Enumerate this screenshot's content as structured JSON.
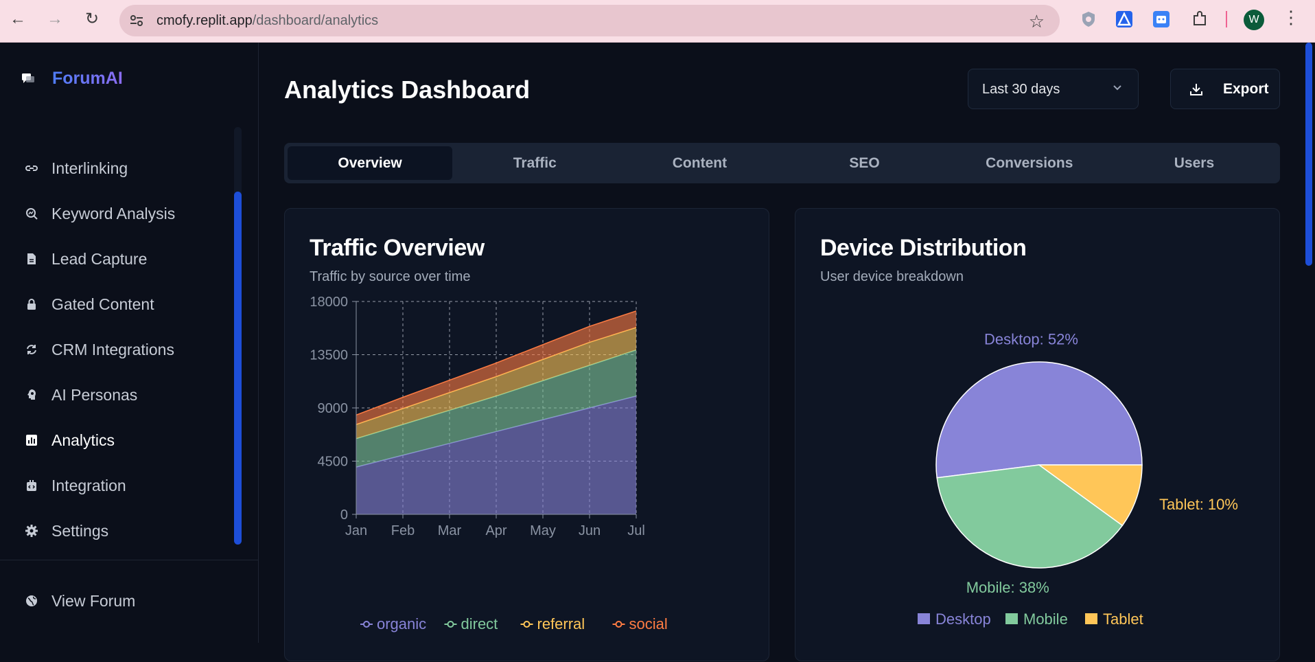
{
  "browser": {
    "url_host": "cmofy.replit.app",
    "url_path": "/dashboard/analytics",
    "avatar_letter": "W"
  },
  "sidebar": {
    "brand": "ForumAI",
    "items": [
      {
        "label": "Interlinking",
        "icon": "link-icon"
      },
      {
        "label": "Keyword Analysis",
        "icon": "search-chart-icon"
      },
      {
        "label": "Lead Capture",
        "icon": "document-icon"
      },
      {
        "label": "Gated Content",
        "icon": "lock-icon"
      },
      {
        "label": "CRM Integrations",
        "icon": "refresh-icon"
      },
      {
        "label": "AI Personas",
        "icon": "head-icon"
      },
      {
        "label": "Analytics",
        "icon": "bar-chart-icon",
        "active": true
      },
      {
        "label": "Integration",
        "icon": "plugin-icon"
      },
      {
        "label": "Settings",
        "icon": "gear-icon"
      }
    ],
    "footer_item": "View Forum"
  },
  "header": {
    "title": "Analytics Dashboard",
    "range": "Last 30 days",
    "export_label": "Export"
  },
  "tabs": [
    "Overview",
    "Traffic",
    "Content",
    "SEO",
    "Conversions",
    "Users"
  ],
  "cards": {
    "traffic": {
      "title": "Traffic Overview",
      "subtitle": "Traffic by source over time"
    },
    "devices": {
      "title": "Device Distribution",
      "subtitle": "User device breakdown"
    }
  },
  "colors": {
    "organic": "#8884d8",
    "direct": "#82ca9d",
    "referral": "#ffc658",
    "social": "#ff7c43",
    "accent": "#1d4ed8"
  },
  "chart_data": [
    {
      "type": "area",
      "stacked": true,
      "x": [
        "Jan",
        "Feb",
        "Mar",
        "Apr",
        "May",
        "Jun",
        "Jul"
      ],
      "ylim": [
        0,
        18000
      ],
      "yticks": [
        0,
        4500,
        9000,
        13500,
        18000
      ],
      "grid": true,
      "legend": "bottom",
      "series": [
        {
          "name": "organic",
          "values": [
            4000,
            5000,
            6000,
            7000,
            8000,
            9000,
            10000
          ]
        },
        {
          "name": "direct",
          "values": [
            2400,
            2600,
            2800,
            3000,
            3300,
            3600,
            3900
          ]
        },
        {
          "name": "referral",
          "values": [
            1200,
            1350,
            1500,
            1650,
            1800,
            1950,
            1900
          ]
        },
        {
          "name": "social",
          "values": [
            800,
            950,
            1050,
            1150,
            1250,
            1350,
            1400
          ]
        }
      ]
    },
    {
      "type": "pie",
      "categories": [
        "Desktop",
        "Mobile",
        "Tablet"
      ],
      "values": [
        52,
        38,
        10
      ],
      "labels": [
        "Desktop: 52%",
        "Mobile: 38%",
        "Tablet: 10%"
      ],
      "legend": "bottom"
    }
  ]
}
